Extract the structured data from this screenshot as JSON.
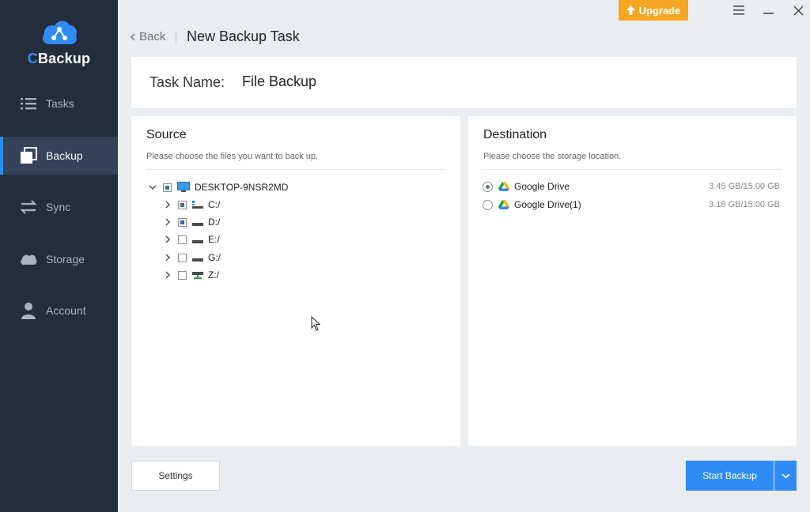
{
  "app": {
    "logo_prefix": "C",
    "logo_rest": "Backup"
  },
  "sidebar": {
    "items": [
      {
        "label": "Tasks",
        "icon": "list-icon",
        "active": false
      },
      {
        "label": "Backup",
        "icon": "backup-icon",
        "active": true
      },
      {
        "label": "Sync",
        "icon": "sync-icon",
        "active": false
      },
      {
        "label": "Storage",
        "icon": "cloud-icon",
        "active": false
      },
      {
        "label": "Account",
        "icon": "user-icon",
        "active": false
      }
    ]
  },
  "topbar": {
    "upgrade_label": "Upgrade",
    "back_label": "Back",
    "page_title": "New Backup Task"
  },
  "task": {
    "label": "Task Name:",
    "value": "File Backup"
  },
  "source": {
    "title": "Source",
    "subtitle": "Please choose the files you want to back up.",
    "root": {
      "label": "DESKTOP-9NSR2MD",
      "checked": "partial",
      "expanded": true
    },
    "drives": [
      {
        "label": "C:/",
        "checked": true,
        "icon": "system-drive-icon"
      },
      {
        "label": "D:/",
        "checked": true,
        "icon": "drive-icon"
      },
      {
        "label": "E:/",
        "checked": false,
        "icon": "drive-icon"
      },
      {
        "label": "G:/",
        "checked": false,
        "icon": "drive-icon"
      },
      {
        "label": "Z:/",
        "checked": false,
        "icon": "network-drive-icon"
      }
    ]
  },
  "destination": {
    "title": "Destination",
    "subtitle": "Please choose the storage location.",
    "items": [
      {
        "label": "Google Drive",
        "size": "3.45 GB/15.00 GB",
        "selected": true
      },
      {
        "label": "Google Drive(1)",
        "size": "3.18 GB/15.00 GB",
        "selected": false
      }
    ]
  },
  "footer": {
    "settings_label": "Settings",
    "start_label": "Start Backup"
  },
  "colors": {
    "sidebar_bg": "#242d3c",
    "accent": "#2f8cf5",
    "upgrade": "#f5a623"
  }
}
